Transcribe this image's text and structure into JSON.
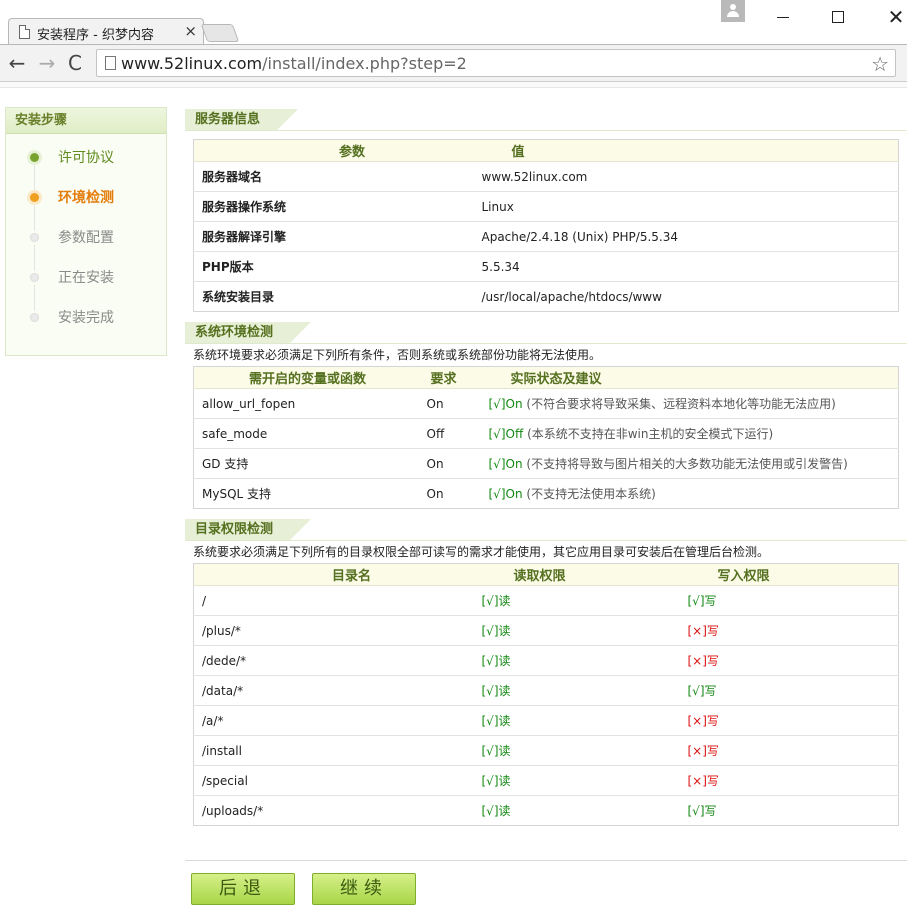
{
  "browser": {
    "tab_title": "安装程序 - 织梦内容",
    "tab_close": "×",
    "url_host": "www.52linux.com",
    "url_path": "/install/index.php?step=2",
    "back": "←",
    "forward": "→",
    "reload": "C",
    "star": "☆",
    "close": "✕"
  },
  "sidebar": {
    "title": "安装步骤",
    "steps": [
      {
        "label": "许可协议",
        "state": "done"
      },
      {
        "label": "环境检测",
        "state": "current"
      },
      {
        "label": "参数配置",
        "state": "todo"
      },
      {
        "label": "正在安装",
        "state": "todo"
      },
      {
        "label": "安装完成",
        "state": "todo"
      }
    ]
  },
  "server_info": {
    "title": "服务器信息",
    "headers": [
      "参数",
      "值"
    ],
    "rows": [
      {
        "param": "服务器域名",
        "value": "www.52linux.com"
      },
      {
        "param": "服务器操作系统",
        "value": "Linux"
      },
      {
        "param": "服务器解译引擎",
        "value": "Apache/2.4.18 (Unix) PHP/5.5.34"
      },
      {
        "param": "PHP版本",
        "value": "5.5.34"
      },
      {
        "param": "系统安装目录",
        "value": "/usr/local/apache/htdocs/www"
      }
    ]
  },
  "env_check": {
    "title": "系统环境检测",
    "note": "系统环境要求必须满足下列所有条件，否则系统或系统部份功能将无法使用。",
    "headers": [
      "需开启的变量或函数",
      "要求",
      "实际状态及建议"
    ],
    "rows": [
      {
        "name": "allow_url_fopen",
        "required": "On",
        "status": "[√]On",
        "hint": "(不符合要求将导致采集、远程资料本地化等功能无法应用)"
      },
      {
        "name": "safe_mode",
        "required": "Off",
        "status": "[√]Off",
        "hint": "(本系统不支持在非win主机的安全模式下运行)"
      },
      {
        "name": "GD 支持",
        "required": "On",
        "status": "[√]On",
        "hint": "(不支持将导致与图片相关的大多数功能无法使用或引发警告)"
      },
      {
        "name": "MySQL 支持",
        "required": "On",
        "status": "[√]On",
        "hint": "(不支持无法使用本系统)"
      }
    ]
  },
  "dir_check": {
    "title": "目录权限检测",
    "note": "系统要求必须满足下列所有的目录权限全部可读写的需求才能使用，其它应用目录可安装后在管理后台检测。",
    "headers": [
      "目录名",
      "读取权限",
      "写入权限"
    ],
    "rows": [
      {
        "dir": "/",
        "read": "[√]读",
        "write": "[√]写",
        "write_ok": true
      },
      {
        "dir": "/plus/*",
        "read": "[√]读",
        "write": "[×]写",
        "write_ok": false
      },
      {
        "dir": "/dede/*",
        "read": "[√]读",
        "write": "[×]写",
        "write_ok": false
      },
      {
        "dir": "/data/*",
        "read": "[√]读",
        "write": "[√]写",
        "write_ok": true
      },
      {
        "dir": "/a/*",
        "read": "[√]读",
        "write": "[×]写",
        "write_ok": false
      },
      {
        "dir": "/install",
        "read": "[√]读",
        "write": "[×]写",
        "write_ok": false
      },
      {
        "dir": "/special",
        "read": "[√]读",
        "write": "[×]写",
        "write_ok": false
      },
      {
        "dir": "/uploads/*",
        "read": "[√]读",
        "write": "[√]写",
        "write_ok": true
      }
    ]
  },
  "buttons": {
    "back": "后退",
    "next": "继续"
  }
}
